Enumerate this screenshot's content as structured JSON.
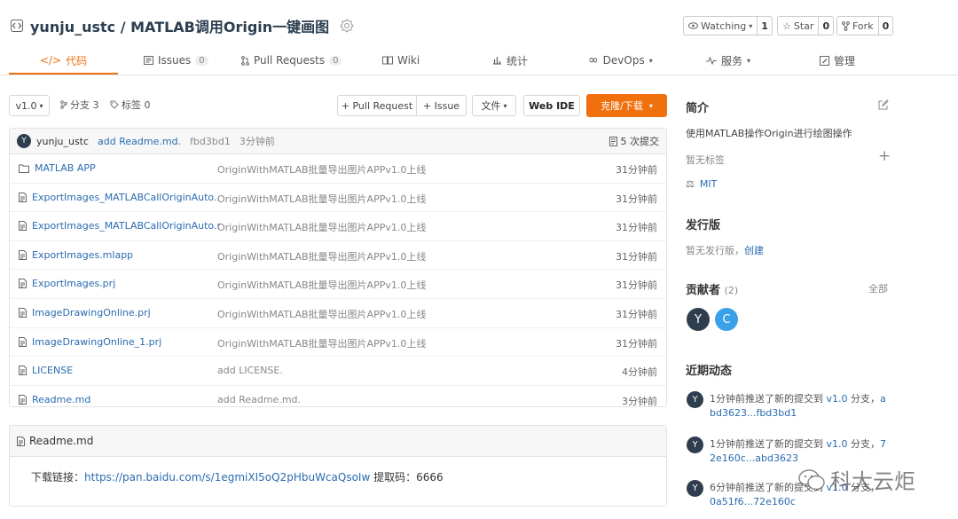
{
  "repo": {
    "owner": "yunju_ustc",
    "separator": " / ",
    "name": "MATLAB调用Origin一键画图",
    "watch_label": "Watching",
    "watch_count": "1",
    "star_label": "Star",
    "star_count": "0",
    "fork_label": "Fork",
    "fork_count": "0"
  },
  "tabs": [
    {
      "label": "代码",
      "icon": "code-icon"
    },
    {
      "label": "Issues",
      "badge": "0",
      "icon": "issues-icon"
    },
    {
      "label": "Pull Requests",
      "badge": "0",
      "icon": "pull-request-icon"
    },
    {
      "label": "Wiki",
      "icon": "wiki-icon"
    },
    {
      "label": "统计",
      "icon": "stats-icon"
    },
    {
      "label": "DevOps",
      "icon": "infinity-icon"
    },
    {
      "label": "服务",
      "icon": "pulse-icon"
    },
    {
      "label": "管理",
      "icon": "manage-icon"
    }
  ],
  "toolbar": {
    "branch": "v1.0",
    "branches": "分支 3",
    "tags": "标签 0",
    "pull_request": "+ Pull Request",
    "issue": "+ Issue",
    "file": "文件",
    "web_ide": "Web IDE",
    "clone": "克隆/下载"
  },
  "colors": {
    "accent": "#f0700e",
    "link": "#2a6bb0"
  },
  "commit": {
    "avatar": "Y",
    "author": "yunju_ustc",
    "message": "add Readme.md.",
    "hash": "fbd3bd1",
    "time": "3分钟前",
    "commits": "5 次提交"
  },
  "files": [
    {
      "name": "MATLAB APP",
      "type": "folder",
      "message": "OriginWithMATLAB批量导出图片APPv1.0上线",
      "time": "31分钟前"
    },
    {
      "name": "ExportImages_MATLABCallOriginAuto....",
      "type": "file",
      "message": "OriginWithMATLAB批量导出图片APPv1.0上线",
      "time": "31分钟前"
    },
    {
      "name": "ExportImages_MATLABCallOriginAuto.m",
      "type": "file",
      "message": "OriginWithMATLAB批量导出图片APPv1.0上线",
      "time": "31分钟前"
    },
    {
      "name": "ExportImages.mlapp",
      "type": "file",
      "message": "OriginWithMATLAB批量导出图片APPv1.0上线",
      "time": "31分钟前"
    },
    {
      "name": "ExportImages.prj",
      "type": "file",
      "message": "OriginWithMATLAB批量导出图片APPv1.0上线",
      "time": "31分钟前"
    },
    {
      "name": "ImageDrawingOnline.prj",
      "type": "file",
      "message": "OriginWithMATLAB批量导出图片APPv1.0上线",
      "time": "31分钟前"
    },
    {
      "name": "ImageDrawingOnline_1.prj",
      "type": "file",
      "message": "OriginWithMATLAB批量导出图片APPv1.0上线",
      "time": "31分钟前"
    },
    {
      "name": "LICENSE",
      "type": "file",
      "message": "add LICENSE.",
      "time": "4分钟前"
    },
    {
      "name": "Readme.md",
      "type": "file",
      "message": "add Readme.md.",
      "time": "3分钟前"
    }
  ],
  "readme": {
    "title": "Readme.md",
    "prefix": "下载链接：",
    "link": "https://pan.baidu.com/s/1egmiXI5oQ2pHbuWcaQsoIw",
    "suffix": " 提取码：6666"
  },
  "sidebar": {
    "intro_title": "简介",
    "intro_desc": "使用MATLAB操作Origin进行绘图操作",
    "no_tags": "暂无标签",
    "license": "MIT",
    "release_title": "发行版",
    "no_release": "暂无发行版，",
    "create": "创建",
    "contrib_title": "贡献者",
    "contrib_count": "(2)",
    "all": "全部",
    "contributors": [
      {
        "initial": "Y",
        "color": "#2f3e4e"
      },
      {
        "initial": "C",
        "color": "#3aa0e8"
      }
    ],
    "activity_title": "近期动态",
    "activities": [
      {
        "avatar": "Y",
        "text": "1分钟前推送了新的提交到 ",
        "branch": "v1.0",
        "mid": " 分支，",
        "commit1": "a",
        "commit2": "bd3623...fbd3bd1"
      },
      {
        "avatar": "Y",
        "text": "1分钟前推送了新的提交到 ",
        "branch": "v1.0",
        "mid": " 分支，",
        "commit1": "7",
        "commit2": "2e160c...abd3623"
      },
      {
        "avatar": "Y",
        "text": "6分钟前推送了新的提交到 ",
        "branch": "v1.0",
        "mid": " 分支，",
        "commit1": "",
        "commit2": "0a51f6...72e160c"
      }
    ]
  },
  "watermark": "科大云炬"
}
